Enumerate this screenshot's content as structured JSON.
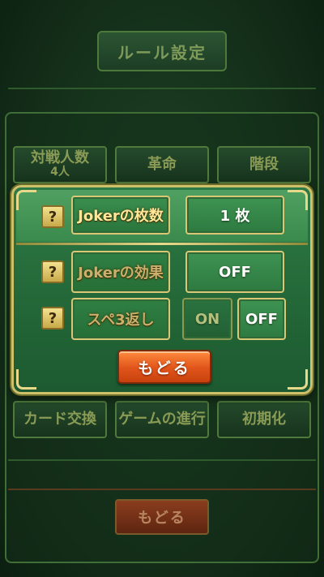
{
  "background": {
    "title": "ルール設定",
    "buttons": [
      {
        "label": "対戦人数",
        "sub": "4人"
      },
      {
        "label": "革命",
        "sub": ""
      },
      {
        "label": "階段",
        "sub": ""
      },
      {
        "label": "カード交換",
        "sub": ""
      },
      {
        "label": "ゲームの進行",
        "sub": ""
      },
      {
        "label": "初期化",
        "sub": ""
      }
    ],
    "back_label": "もどる"
  },
  "dialog": {
    "rows": [
      {
        "help": "?",
        "label": "Jokerの枚数",
        "value": "1 枚"
      },
      {
        "help": "?",
        "label": "Jokerの効果",
        "value": "OFF"
      },
      {
        "help": "?",
        "label": "スペ3返し",
        "on_label": "ON",
        "off_label": "OFF",
        "selected": "OFF"
      }
    ],
    "back_label": "もどる"
  },
  "colors": {
    "accent_gold": "#d7c776",
    "back_button": "#e0541a",
    "panel_green": "#2e7a46"
  }
}
